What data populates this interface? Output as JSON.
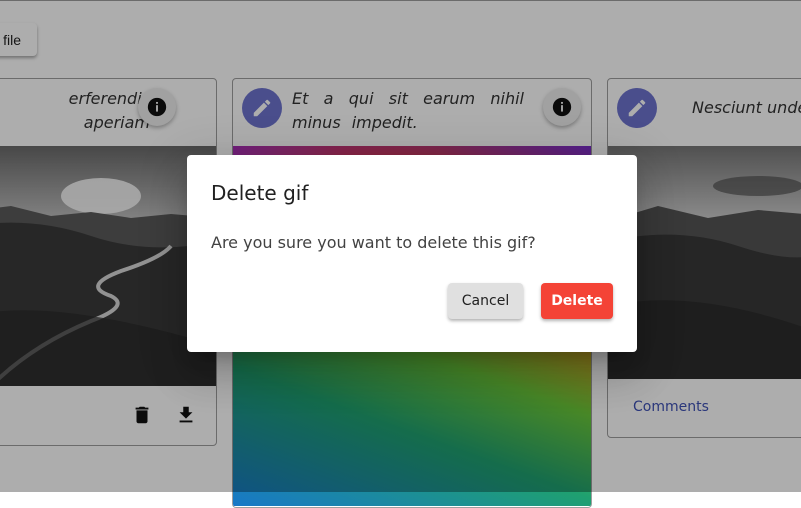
{
  "toolbar": {
    "file_button_label": "file"
  },
  "cards": [
    {
      "caption": "erferendis aperiam"
    },
    {
      "caption": "Et a qui sit earum nihil minus impedit."
    },
    {
      "caption": "Nesciunt unde a",
      "comments_label": "Comments"
    }
  ],
  "dialog": {
    "title": "Delete gif",
    "message": "Are you sure you want to delete this gif?",
    "cancel_label": "Cancel",
    "delete_label": "Delete"
  },
  "colors": {
    "accent": "#6d73cf",
    "danger": "#f44336",
    "link": "#3f51b5"
  },
  "icons": [
    "info-icon",
    "pencil-icon",
    "trash-icon",
    "download-icon"
  ]
}
